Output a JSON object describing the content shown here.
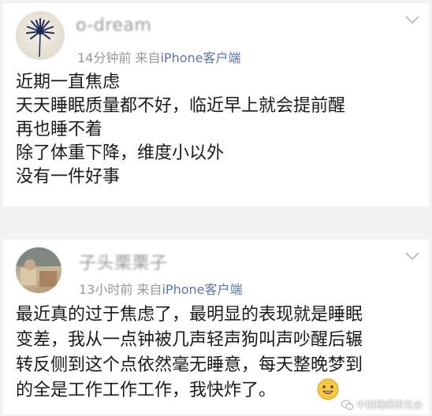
{
  "comments": [
    {
      "username": "o-dream",
      "time": "14分钟前",
      "source_prefix": "来自",
      "source": "iPhone客户端",
      "lines": [
        "近期一直焦虑",
        "天天睡眠质量都不好，临近早上就会提前醒",
        "再也睡不着",
        "除了体重下降，维度小以外",
        "没有一件好事"
      ]
    },
    {
      "username": "子头栗栗子",
      "time": "13小时前",
      "source_prefix": "来自",
      "source": "iPhone客户端",
      "lines": [
        "最近真的过于焦虑了，最明显的表现就是睡眠",
        "变差，我从一点钟被几声轻声狗叫声吵醒后辗",
        "转反侧到这个点依然毫无睡意，每天整晚梦到",
        "的全是工作工作工作，我快炸了。"
      ]
    }
  ],
  "watermark": "中国睡眠研究会",
  "icons": {
    "avatar1": "dark-flower-avatar",
    "avatar2": "photo-avatar",
    "menu": "chevron-down-icon",
    "emoji": "grin-emoji-icon",
    "watermark": "wechat-icon"
  }
}
